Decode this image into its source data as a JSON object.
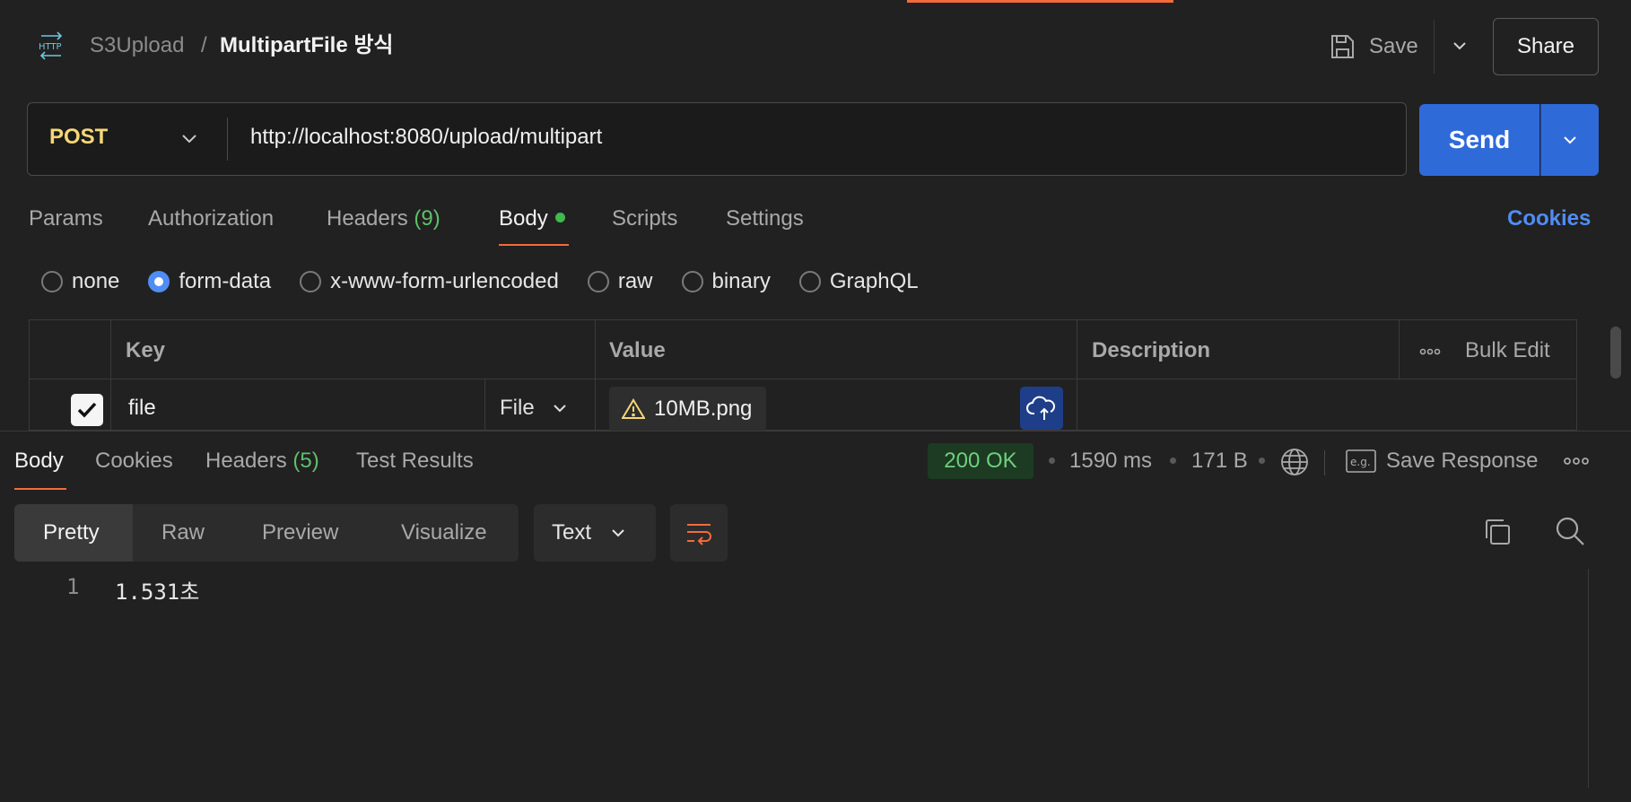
{
  "header": {
    "icon": "http-icon",
    "collection": "S3Upload",
    "separator": "/",
    "title": "MultipartFile 방식",
    "save_label": "Save",
    "share_label": "Share"
  },
  "request": {
    "method": "POST",
    "url": "http://localhost:8080/upload/multipart",
    "send_label": "Send"
  },
  "request_tabs": {
    "params": "Params",
    "authorization": "Authorization",
    "headers": "Headers",
    "headers_count": "(9)",
    "body": "Body",
    "scripts": "Scripts",
    "settings": "Settings",
    "cookies": "Cookies"
  },
  "body_types": {
    "none": "none",
    "form_data": "form-data",
    "urlencoded": "x-www-form-urlencoded",
    "raw": "raw",
    "binary": "binary",
    "graphql": "GraphQL",
    "selected": "form-data"
  },
  "form_table": {
    "col_key": "Key",
    "col_value": "Value",
    "col_description": "Description",
    "bulk_edit": "Bulk Edit",
    "rows": [
      {
        "checked": true,
        "key": "file",
        "type": "File",
        "value": "10MB.png",
        "description": ""
      }
    ]
  },
  "response": {
    "tabs": {
      "body": "Body",
      "cookies": "Cookies",
      "headers": "Headers",
      "headers_count": "(5)",
      "test_results": "Test Results"
    },
    "status": "200 OK",
    "time": "1590 ms",
    "size": "171 B",
    "save_response": "Save Response",
    "views": {
      "pretty": "Pretty",
      "raw": "Raw",
      "preview": "Preview",
      "visualize": "Visualize"
    },
    "format": "Text",
    "lines": [
      {
        "num": "1",
        "text": "1.531초"
      }
    ]
  },
  "colors": {
    "accent": "#f26b3a",
    "send": "#2f6ad9",
    "method": "#f6d776",
    "status_ok": "#6fcf7c",
    "link": "#4f8df5"
  }
}
